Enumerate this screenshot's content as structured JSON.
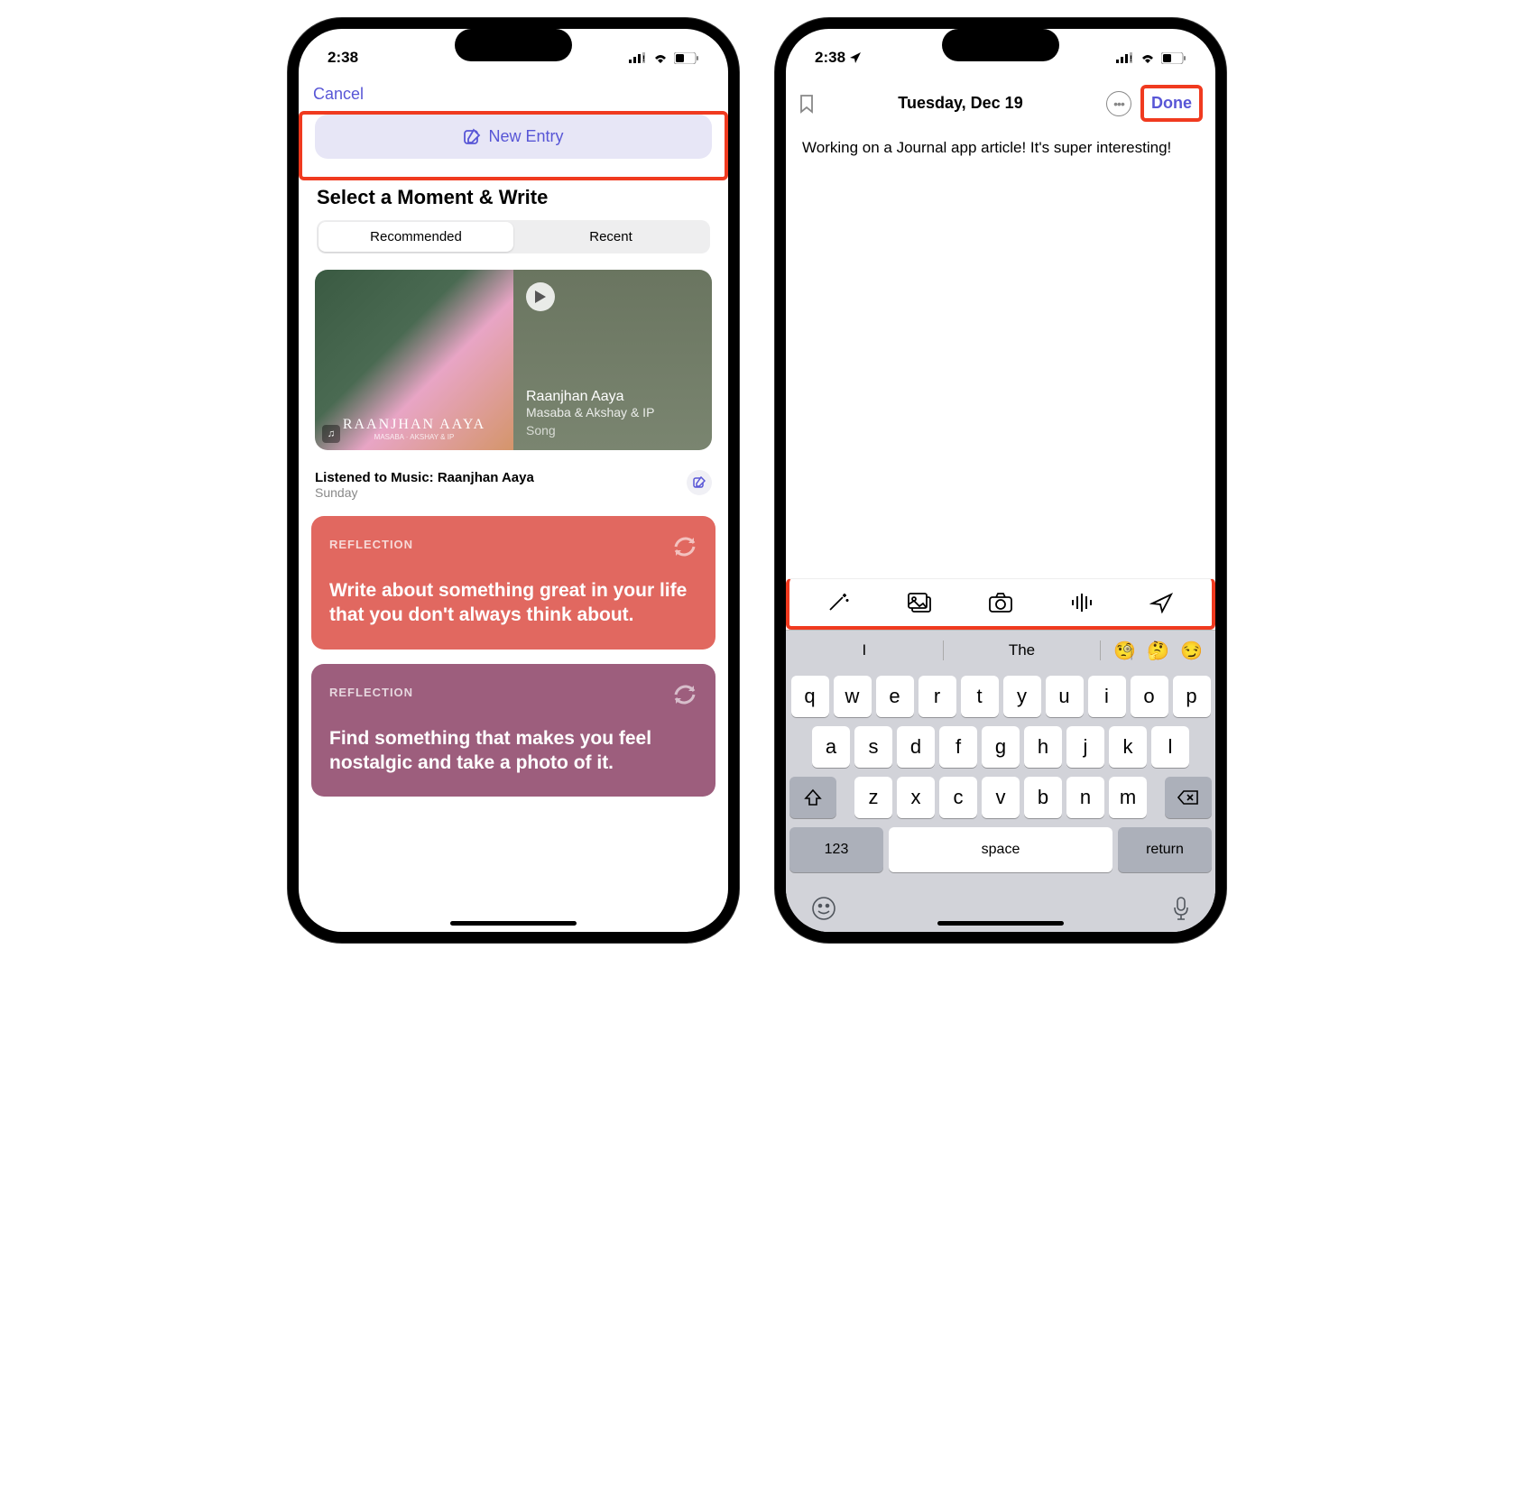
{
  "status": {
    "time": "2:38"
  },
  "left": {
    "cancel": "Cancel",
    "newEntry": "New Entry",
    "sectionTitle": "Select a Moment & Write",
    "tabs": {
      "recommended": "Recommended",
      "recent": "Recent"
    },
    "moment": {
      "albumTitle": "RAANJHAN AAYA",
      "albumSub": "MASABA · AKSHAY & IP",
      "songTitle": "Raanjhan Aaya",
      "artist": "Masaba & Akshay & IP",
      "type": "Song",
      "metaTitle": "Listened to Music: Raanjhan Aaya",
      "metaDay": "Sunday"
    },
    "reflections": [
      {
        "label": "REFLECTION",
        "text": "Write about something great in your life that you don't always think about."
      },
      {
        "label": "REFLECTION",
        "text": "Find something that makes you feel nostalgic and take a photo of it."
      }
    ]
  },
  "right": {
    "date": "Tuesday, Dec 19",
    "done": "Done",
    "body": "Working on a Journal app article! It's super interesting!",
    "suggestions": {
      "s1": "I",
      "s2": "The"
    },
    "keys": {
      "r1": [
        "q",
        "w",
        "e",
        "r",
        "t",
        "y",
        "u",
        "i",
        "o",
        "p"
      ],
      "r2": [
        "a",
        "s",
        "d",
        "f",
        "g",
        "h",
        "j",
        "k",
        "l"
      ],
      "r3": [
        "z",
        "x",
        "c",
        "v",
        "b",
        "n",
        "m"
      ],
      "k123": "123",
      "space": "space",
      "kreturn": "return"
    }
  }
}
